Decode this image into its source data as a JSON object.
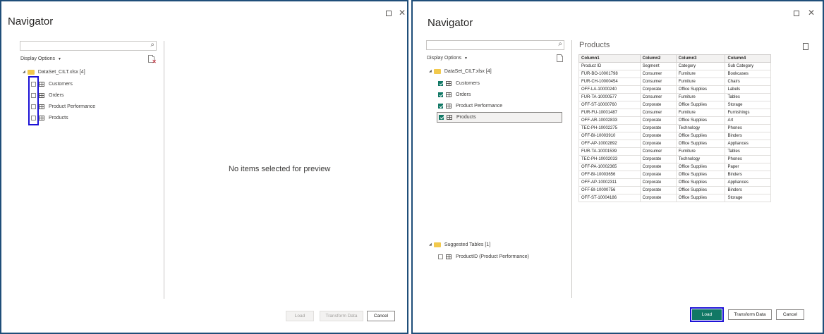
{
  "left": {
    "title": "Navigator",
    "search": {
      "placeholder": ""
    },
    "display_options": "Display Options",
    "folder": "DataSet_CILT.xlsx [4]",
    "items": [
      {
        "label": "Customers",
        "checked": false
      },
      {
        "label": "Orders",
        "checked": false
      },
      {
        "label": "Product Performance",
        "checked": false
      },
      {
        "label": "Products",
        "checked": false
      }
    ],
    "empty_message": "No items selected for preview",
    "buttons": {
      "load": "Load",
      "transform": "Transform Data",
      "cancel": "Cancel"
    }
  },
  "right": {
    "title": "Navigator",
    "search": {
      "placeholder": ""
    },
    "display_options": "Display Options",
    "folder": "DataSet_CILT.xlsx [4]",
    "items": [
      {
        "label": "Customers",
        "checked": true
      },
      {
        "label": "Orders",
        "checked": true
      },
      {
        "label": "Product Performance",
        "checked": true
      },
      {
        "label": "Products",
        "checked": true,
        "selected": true
      }
    ],
    "suggested_folder": "Suggested Tables [1]",
    "suggested_items": [
      {
        "label": "ProductID (Product Performance)",
        "checked": false
      }
    ],
    "preview": {
      "title": "Products",
      "columns": [
        "Column1",
        "Column2",
        "Column3",
        "Column4"
      ],
      "rows": [
        [
          "Product ID",
          "Segment",
          "Category",
          "Sub Category"
        ],
        [
          "FUR-BO-10001798",
          "Consumer",
          "Furniture",
          "Bookcases"
        ],
        [
          "FUR-CH-10000454",
          "Consumer",
          "Furniture",
          "Chairs"
        ],
        [
          "OFF-LA-10000240",
          "Corporate",
          "Office Supplies",
          "Labels"
        ],
        [
          "FUR-TA-10000577",
          "Consumer",
          "Furniture",
          "Tables"
        ],
        [
          "OFF-ST-10000760",
          "Corporate",
          "Office Supplies",
          "Storage"
        ],
        [
          "FUR-FU-10001487",
          "Consumer",
          "Furniture",
          "Furnishings"
        ],
        [
          "OFF-AR-10002833",
          "Corporate",
          "Office Supplies",
          "Art"
        ],
        [
          "TEC-PH-10002275",
          "Corporate",
          "Technology",
          "Phones"
        ],
        [
          "OFF-BI-10003910",
          "Corporate",
          "Office Supplies",
          "Binders"
        ],
        [
          "OFF-AP-10002892",
          "Corporate",
          "Office Supplies",
          "Appliances"
        ],
        [
          "FUR-TA-10001539",
          "Consumer",
          "Furniture",
          "Tables"
        ],
        [
          "TEC-PH-10002033",
          "Corporate",
          "Technology",
          "Phones"
        ],
        [
          "OFF-PA-10002365",
          "Corporate",
          "Office Supplies",
          "Paper"
        ],
        [
          "OFF-BI-10003656",
          "Corporate",
          "Office Supplies",
          "Binders"
        ],
        [
          "OFF-AP-10002311",
          "Corporate",
          "Office Supplies",
          "Appliances"
        ],
        [
          "OFF-BI-10000756",
          "Corporate",
          "Office Supplies",
          "Binders"
        ],
        [
          "OFF-ST-10004186",
          "Corporate",
          "Office Supplies",
          "Storage"
        ]
      ]
    },
    "buttons": {
      "load": "Load",
      "transform": "Transform Data",
      "cancel": "Cancel"
    }
  },
  "colors": {
    "accent": "#117865",
    "highlight": "#1c12d6",
    "frame": "#1f4e79"
  }
}
